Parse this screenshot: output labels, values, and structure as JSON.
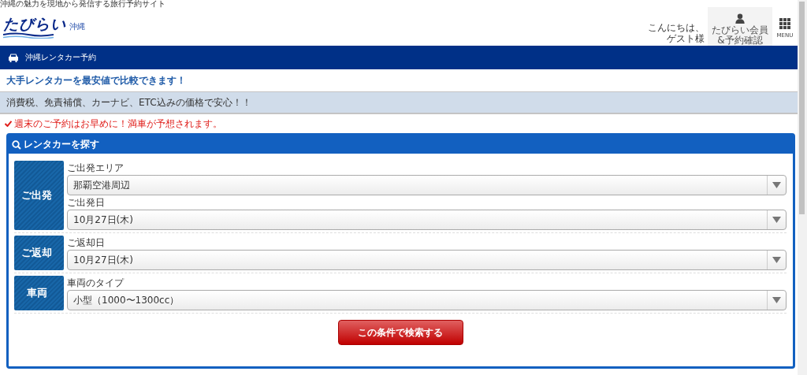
{
  "header": {
    "tagline": "沖縄の魅力を現地から発信する旅行予約サイト",
    "logo": "たびらい",
    "region": "沖縄",
    "greeting": [
      "こんにちは、",
      "ゲスト様"
    ],
    "member_link": [
      "たびらい会員",
      "&予約確認"
    ],
    "menu_label": "MENU"
  },
  "nav_bar": {
    "title": "沖縄レンタカー予約"
  },
  "intro": "大手レンタカーを最安値で比較できます！",
  "info_banner": "消費税、免責補償、カーナビ、ETC込みの価格で安心！！",
  "notice": "週末のご予約はお早めに！満車が予想されます。",
  "search_panel": {
    "title": "レンタカーを探す",
    "groups": [
      {
        "label": "ご出発",
        "fields": [
          {
            "label": "ご出発エリア",
            "value": "那覇空港周辺"
          },
          {
            "label": "ご出発日",
            "value": "10月27日(木)"
          }
        ]
      },
      {
        "label": "ご返却",
        "fields": [
          {
            "label": "ご返却日",
            "value": "10月27日(木)"
          }
        ]
      },
      {
        "label": "車両",
        "fields": [
          {
            "label": "車両のタイプ",
            "value": "小型（1000〜1300cc）"
          }
        ]
      }
    ],
    "search_button": "この条件で検索する"
  }
}
